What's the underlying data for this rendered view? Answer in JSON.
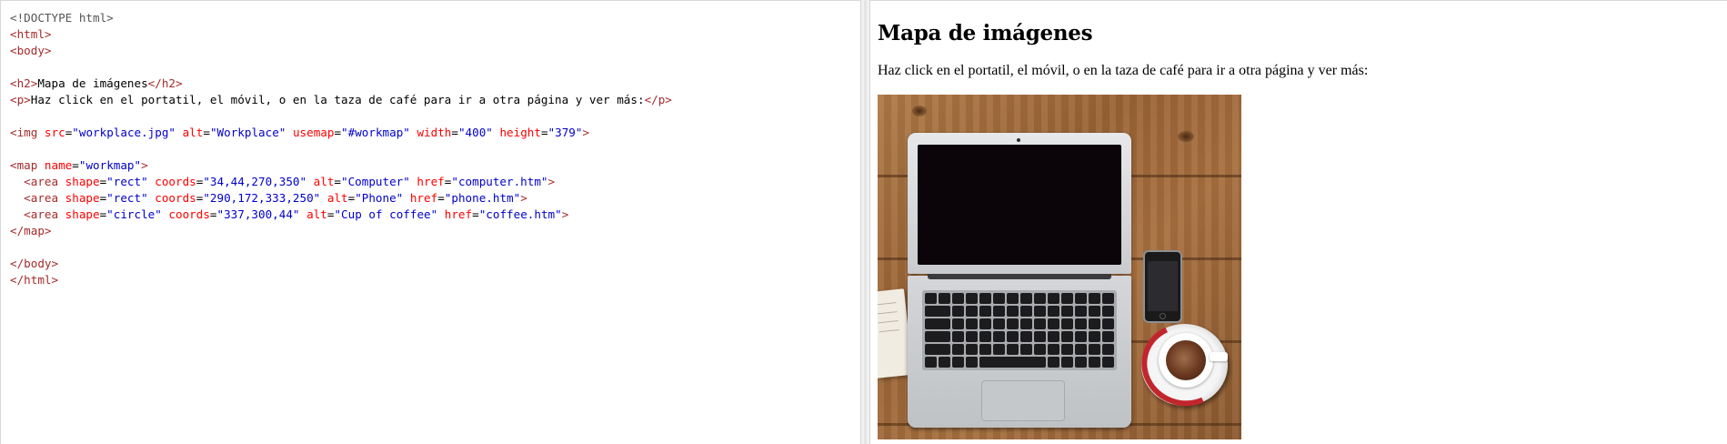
{
  "editor": {
    "lines": [
      [
        {
          "t": "<!DOCTYPE html>",
          "c": "doctype"
        }
      ],
      [
        {
          "t": "<html>",
          "c": "tag"
        }
      ],
      [
        {
          "t": "<body>",
          "c": "tag"
        }
      ],
      [],
      [
        {
          "t": "<h2>",
          "c": "tag"
        },
        {
          "t": "Mapa de imágenes",
          "c": "text"
        },
        {
          "t": "</h2>",
          "c": "tag"
        }
      ],
      [
        {
          "t": "<p>",
          "c": "tag"
        },
        {
          "t": "Haz click en el portatil, el móvil, o en la taza de café para ir a otra página y ver más:",
          "c": "text"
        },
        {
          "t": "</p>",
          "c": "tag"
        }
      ],
      [],
      [
        {
          "t": "<img",
          "c": "tag"
        },
        {
          "t": " src",
          "c": "attr"
        },
        {
          "t": "=",
          "c": "text"
        },
        {
          "t": "\"workplace.jpg\"",
          "c": "val"
        },
        {
          "t": " alt",
          "c": "attr"
        },
        {
          "t": "=",
          "c": "text"
        },
        {
          "t": "\"Workplace\"",
          "c": "val"
        },
        {
          "t": " usemap",
          "c": "attr"
        },
        {
          "t": "=",
          "c": "text"
        },
        {
          "t": "\"#workmap\"",
          "c": "val"
        },
        {
          "t": " width",
          "c": "attr"
        },
        {
          "t": "=",
          "c": "text"
        },
        {
          "t": "\"400\"",
          "c": "val"
        },
        {
          "t": " height",
          "c": "attr"
        },
        {
          "t": "=",
          "c": "text"
        },
        {
          "t": "\"379\"",
          "c": "val"
        },
        {
          "t": ">",
          "c": "tag"
        }
      ],
      [],
      [
        {
          "t": "<map",
          "c": "tag"
        },
        {
          "t": " name",
          "c": "attr"
        },
        {
          "t": "=",
          "c": "text"
        },
        {
          "t": "\"workmap\"",
          "c": "val"
        },
        {
          "t": ">",
          "c": "tag"
        }
      ],
      [
        {
          "t": "  <area",
          "c": "tag"
        },
        {
          "t": " shape",
          "c": "attr"
        },
        {
          "t": "=",
          "c": "text"
        },
        {
          "t": "\"rect\"",
          "c": "val"
        },
        {
          "t": " coords",
          "c": "attr"
        },
        {
          "t": "=",
          "c": "text"
        },
        {
          "t": "\"34,44,270,350\"",
          "c": "val"
        },
        {
          "t": " alt",
          "c": "attr"
        },
        {
          "t": "=",
          "c": "text"
        },
        {
          "t": "\"Computer\"",
          "c": "val"
        },
        {
          "t": " href",
          "c": "attr"
        },
        {
          "t": "=",
          "c": "text"
        },
        {
          "t": "\"computer.htm\"",
          "c": "val"
        },
        {
          "t": ">",
          "c": "tag"
        }
      ],
      [
        {
          "t": "  <area",
          "c": "tag"
        },
        {
          "t": " shape",
          "c": "attr"
        },
        {
          "t": "=",
          "c": "text"
        },
        {
          "t": "\"rect\"",
          "c": "val"
        },
        {
          "t": " coords",
          "c": "attr"
        },
        {
          "t": "=",
          "c": "text"
        },
        {
          "t": "\"290,172,333,250\"",
          "c": "val"
        },
        {
          "t": " alt",
          "c": "attr"
        },
        {
          "t": "=",
          "c": "text"
        },
        {
          "t": "\"Phone\"",
          "c": "val"
        },
        {
          "t": " href",
          "c": "attr"
        },
        {
          "t": "=",
          "c": "text"
        },
        {
          "t": "\"phone.htm\"",
          "c": "val"
        },
        {
          "t": ">",
          "c": "tag"
        }
      ],
      [
        {
          "t": "  <area",
          "c": "tag"
        },
        {
          "t": " shape",
          "c": "attr"
        },
        {
          "t": "=",
          "c": "text"
        },
        {
          "t": "\"circle\"",
          "c": "val"
        },
        {
          "t": " coords",
          "c": "attr"
        },
        {
          "t": "=",
          "c": "text"
        },
        {
          "t": "\"337,300,44\"",
          "c": "val"
        },
        {
          "t": " alt",
          "c": "attr"
        },
        {
          "t": "=",
          "c": "text"
        },
        {
          "t": "\"Cup of coffee\"",
          "c": "val"
        },
        {
          "t": " href",
          "c": "attr"
        },
        {
          "t": "=",
          "c": "text"
        },
        {
          "t": "\"coffee.htm\"",
          "c": "val"
        },
        {
          "t": ">",
          "c": "tag"
        }
      ],
      [
        {
          "t": "</map>",
          "c": "tag"
        }
      ],
      [],
      [
        {
          "t": "</body>",
          "c": "tag"
        }
      ],
      [
        {
          "t": "</html>",
          "c": "tag"
        }
      ]
    ]
  },
  "result": {
    "heading": "Mapa de imágenes",
    "paragraph": "Haz click en el portatil, el móvil, o en la taza de café para ir a otra página y ver más:",
    "image": {
      "alt": "Workplace",
      "areas": [
        {
          "alt": "Computer",
          "href": "computer.htm",
          "shape": "rect",
          "coords": "34,44,270,350"
        },
        {
          "alt": "Phone",
          "href": "phone.htm",
          "shape": "rect",
          "coords": "290,172,333,250"
        },
        {
          "alt": "Cup of coffee",
          "href": "coffee.htm",
          "shape": "circle",
          "coords": "337,300,44"
        }
      ]
    }
  },
  "colors": {
    "tag": "#a52a2a",
    "attr": "#ff0000",
    "value": "#0000cd",
    "doctype": "#555555",
    "text": "#000000"
  }
}
